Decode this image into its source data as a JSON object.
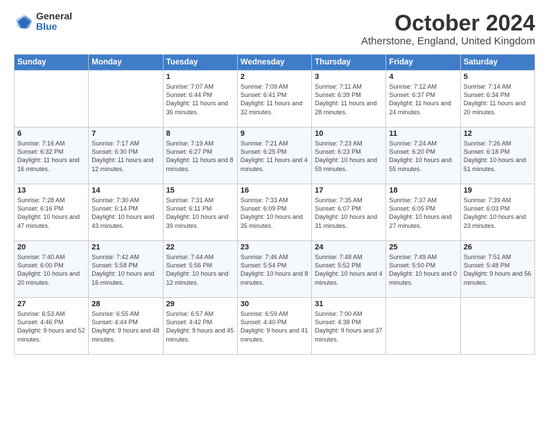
{
  "header": {
    "logo_general": "General",
    "logo_blue": "Blue",
    "month_title": "October 2024",
    "location": "Atherstone, England, United Kingdom"
  },
  "days_of_week": [
    "Sunday",
    "Monday",
    "Tuesday",
    "Wednesday",
    "Thursday",
    "Friday",
    "Saturday"
  ],
  "weeks": [
    [
      {
        "day": "",
        "sunrise": "",
        "sunset": "",
        "daylight": ""
      },
      {
        "day": "",
        "sunrise": "",
        "sunset": "",
        "daylight": ""
      },
      {
        "day": "1",
        "sunrise": "Sunrise: 7:07 AM",
        "sunset": "Sunset: 6:44 PM",
        "daylight": "Daylight: 11 hours and 36 minutes."
      },
      {
        "day": "2",
        "sunrise": "Sunrise: 7:09 AM",
        "sunset": "Sunset: 6:41 PM",
        "daylight": "Daylight: 11 hours and 32 minutes."
      },
      {
        "day": "3",
        "sunrise": "Sunrise: 7:11 AM",
        "sunset": "Sunset: 6:39 PM",
        "daylight": "Daylight: 11 hours and 28 minutes."
      },
      {
        "day": "4",
        "sunrise": "Sunrise: 7:12 AM",
        "sunset": "Sunset: 6:37 PM",
        "daylight": "Daylight: 11 hours and 24 minutes."
      },
      {
        "day": "5",
        "sunrise": "Sunrise: 7:14 AM",
        "sunset": "Sunset: 6:34 PM",
        "daylight": "Daylight: 11 hours and 20 minutes."
      }
    ],
    [
      {
        "day": "6",
        "sunrise": "Sunrise: 7:16 AM",
        "sunset": "Sunset: 6:32 PM",
        "daylight": "Daylight: 11 hours and 16 minutes."
      },
      {
        "day": "7",
        "sunrise": "Sunrise: 7:17 AM",
        "sunset": "Sunset: 6:30 PM",
        "daylight": "Daylight: 11 hours and 12 minutes."
      },
      {
        "day": "8",
        "sunrise": "Sunrise: 7:19 AM",
        "sunset": "Sunset: 6:27 PM",
        "daylight": "Daylight: 11 hours and 8 minutes."
      },
      {
        "day": "9",
        "sunrise": "Sunrise: 7:21 AM",
        "sunset": "Sunset: 6:25 PM",
        "daylight": "Daylight: 11 hours and 4 minutes."
      },
      {
        "day": "10",
        "sunrise": "Sunrise: 7:23 AM",
        "sunset": "Sunset: 6:23 PM",
        "daylight": "Daylight: 10 hours and 59 minutes."
      },
      {
        "day": "11",
        "sunrise": "Sunrise: 7:24 AM",
        "sunset": "Sunset: 6:20 PM",
        "daylight": "Daylight: 10 hours and 55 minutes."
      },
      {
        "day": "12",
        "sunrise": "Sunrise: 7:26 AM",
        "sunset": "Sunset: 6:18 PM",
        "daylight": "Daylight: 10 hours and 51 minutes."
      }
    ],
    [
      {
        "day": "13",
        "sunrise": "Sunrise: 7:28 AM",
        "sunset": "Sunset: 6:16 PM",
        "daylight": "Daylight: 10 hours and 47 minutes."
      },
      {
        "day": "14",
        "sunrise": "Sunrise: 7:30 AM",
        "sunset": "Sunset: 6:14 PM",
        "daylight": "Daylight: 10 hours and 43 minutes."
      },
      {
        "day": "15",
        "sunrise": "Sunrise: 7:31 AM",
        "sunset": "Sunset: 6:11 PM",
        "daylight": "Daylight: 10 hours and 39 minutes."
      },
      {
        "day": "16",
        "sunrise": "Sunrise: 7:33 AM",
        "sunset": "Sunset: 6:09 PM",
        "daylight": "Daylight: 10 hours and 35 minutes."
      },
      {
        "day": "17",
        "sunrise": "Sunrise: 7:35 AM",
        "sunset": "Sunset: 6:07 PM",
        "daylight": "Daylight: 10 hours and 31 minutes."
      },
      {
        "day": "18",
        "sunrise": "Sunrise: 7:37 AM",
        "sunset": "Sunset: 6:05 PM",
        "daylight": "Daylight: 10 hours and 27 minutes."
      },
      {
        "day": "19",
        "sunrise": "Sunrise: 7:39 AM",
        "sunset": "Sunset: 6:03 PM",
        "daylight": "Daylight: 10 hours and 23 minutes."
      }
    ],
    [
      {
        "day": "20",
        "sunrise": "Sunrise: 7:40 AM",
        "sunset": "Sunset: 6:00 PM",
        "daylight": "Daylight: 10 hours and 20 minutes."
      },
      {
        "day": "21",
        "sunrise": "Sunrise: 7:42 AM",
        "sunset": "Sunset: 5:58 PM",
        "daylight": "Daylight: 10 hours and 16 minutes."
      },
      {
        "day": "22",
        "sunrise": "Sunrise: 7:44 AM",
        "sunset": "Sunset: 5:56 PM",
        "daylight": "Daylight: 10 hours and 12 minutes."
      },
      {
        "day": "23",
        "sunrise": "Sunrise: 7:46 AM",
        "sunset": "Sunset: 5:54 PM",
        "daylight": "Daylight: 10 hours and 8 minutes."
      },
      {
        "day": "24",
        "sunrise": "Sunrise: 7:48 AM",
        "sunset": "Sunset: 5:52 PM",
        "daylight": "Daylight: 10 hours and 4 minutes."
      },
      {
        "day": "25",
        "sunrise": "Sunrise: 7:49 AM",
        "sunset": "Sunset: 5:50 PM",
        "daylight": "Daylight: 10 hours and 0 minutes."
      },
      {
        "day": "26",
        "sunrise": "Sunrise: 7:51 AM",
        "sunset": "Sunset: 5:48 PM",
        "daylight": "Daylight: 9 hours and 56 minutes."
      }
    ],
    [
      {
        "day": "27",
        "sunrise": "Sunrise: 6:53 AM",
        "sunset": "Sunset: 4:46 PM",
        "daylight": "Daylight: 9 hours and 52 minutes."
      },
      {
        "day": "28",
        "sunrise": "Sunrise: 6:55 AM",
        "sunset": "Sunset: 4:44 PM",
        "daylight": "Daylight: 9 hours and 48 minutes."
      },
      {
        "day": "29",
        "sunrise": "Sunrise: 6:57 AM",
        "sunset": "Sunset: 4:42 PM",
        "daylight": "Daylight: 9 hours and 45 minutes."
      },
      {
        "day": "30",
        "sunrise": "Sunrise: 6:59 AM",
        "sunset": "Sunset: 4:40 PM",
        "daylight": "Daylight: 9 hours and 41 minutes."
      },
      {
        "day": "31",
        "sunrise": "Sunrise: 7:00 AM",
        "sunset": "Sunset: 4:38 PM",
        "daylight": "Daylight: 9 hours and 37 minutes."
      },
      {
        "day": "",
        "sunrise": "",
        "sunset": "",
        "daylight": ""
      },
      {
        "day": "",
        "sunrise": "",
        "sunset": "",
        "daylight": ""
      }
    ]
  ]
}
